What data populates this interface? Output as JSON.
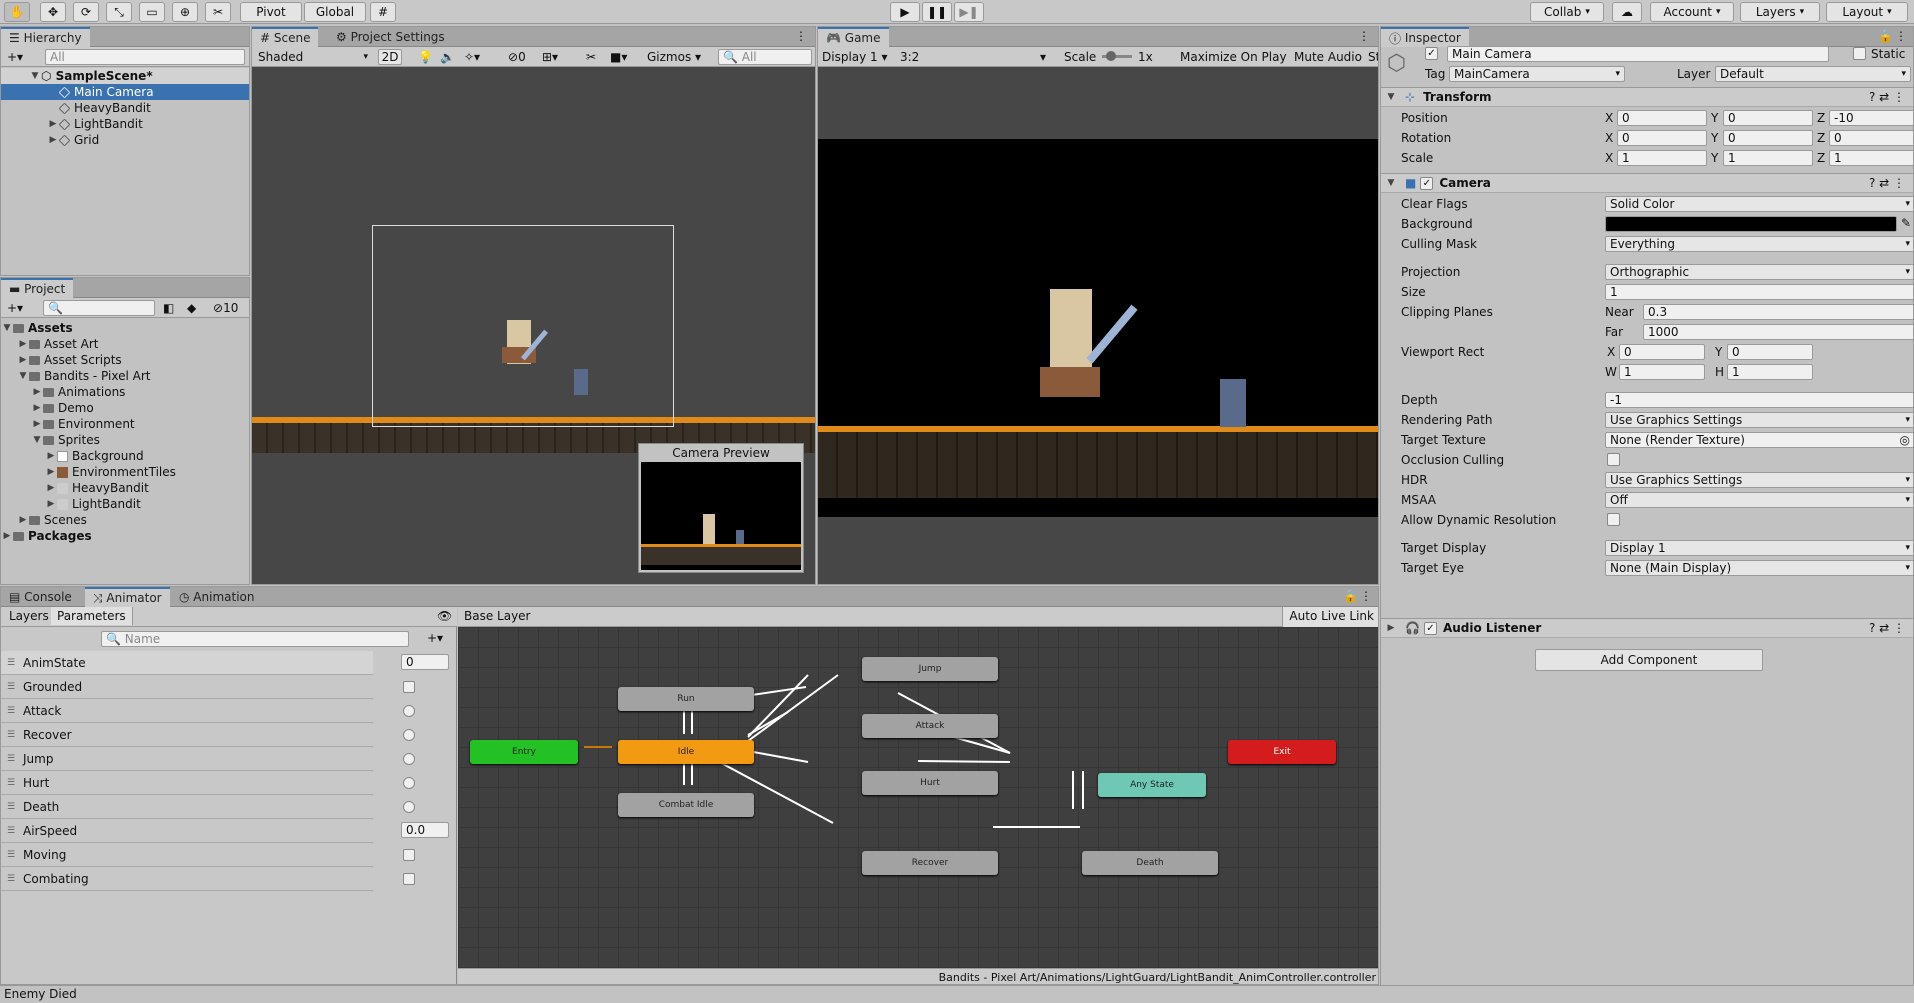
{
  "toolbar": {
    "pivot": "Pivot",
    "global": "Global",
    "collab": "Collab",
    "account": "Account",
    "layers": "Layers",
    "layout": "Layout"
  },
  "hierarchy": {
    "tab": "Hierarchy",
    "search": "All",
    "scene": "SampleScene*",
    "items": [
      "Main Camera",
      "HeavyBandit",
      "LightBandit",
      "Grid"
    ]
  },
  "project": {
    "tab": "Project",
    "count": "10",
    "root": "Assets",
    "items": [
      "Asset Art",
      "Asset Scripts",
      "Bandits - Pixel Art",
      "Animations",
      "Demo",
      "Environment",
      "Sprites",
      "Background",
      "EnvironmentTiles",
      "HeavyBandit",
      "LightBandit",
      "Scenes"
    ],
    "packages": "Packages"
  },
  "scene": {
    "tab": "Scene",
    "tab2": "Project Settings",
    "shading": "Shaded",
    "mode2d": "2D",
    "gizmos": "Gizmos",
    "search": "All",
    "hidden_count": "0",
    "preview_title": "Camera Preview"
  },
  "game": {
    "tab": "Game",
    "display": "Display 1",
    "aspect": "3:2",
    "scale_label": "Scale",
    "scale_value": "1x",
    "maximize": "Maximize On Play",
    "mute": "Mute Audio",
    "stats": "St"
  },
  "inspector": {
    "tab": "Inspector",
    "name": "Main Camera",
    "static": "Static",
    "tag_label": "Tag",
    "tag": "MainCamera",
    "layer_label": "Layer",
    "layer": "Default",
    "transform": {
      "title": "Transform",
      "rows": [
        {
          "label": "Position",
          "x": "0",
          "y": "0",
          "z": "-10"
        },
        {
          "label": "Rotation",
          "x": "0",
          "y": "0",
          "z": "0"
        },
        {
          "label": "Scale",
          "x": "1",
          "y": "1",
          "z": "1"
        }
      ]
    },
    "camera": {
      "title": "Camera",
      "clear_flags": "Solid Color",
      "culling_mask": "Everything",
      "projection": "Orthographic",
      "size": "1",
      "near": "0.3",
      "far": "1000",
      "vx": "0",
      "vy": "0",
      "vw": "1",
      "vh": "1",
      "depth": "-1",
      "rendering_path": "Use Graphics Settings",
      "target_texture": "None (Render Texture)",
      "hdr": "Use Graphics Settings",
      "msaa": "Off",
      "target_display": "Display 1",
      "target_eye": "None (Main Display)",
      "labels": {
        "clear_flags": "Clear Flags",
        "background": "Background",
        "culling_mask": "Culling Mask",
        "projection": "Projection",
        "size": "Size",
        "clipping": "Clipping Planes",
        "near": "Near",
        "far": "Far",
        "viewport": "Viewport Rect",
        "depth": "Depth",
        "rendering_path": "Rendering Path",
        "target_texture": "Target Texture",
        "occlusion": "Occlusion Culling",
        "hdr": "HDR",
        "msaa": "MSAA",
        "dynres": "Allow Dynamic Resolution",
        "target_display": "Target Display",
        "target_eye": "Target Eye"
      }
    },
    "audio": {
      "title": "Audio Listener"
    },
    "add_component": "Add Component"
  },
  "bottom": {
    "tabs": [
      "Console",
      "Animator",
      "Animation"
    ],
    "layers": "Layers",
    "parameters": "Parameters",
    "name_search": "Name",
    "base_layer": "Base Layer",
    "auto_live": "Auto Live Link",
    "path": "Bandits - Pixel Art/Animations/LightGuard/LightBandit_AnimController.controller",
    "params": [
      {
        "name": "AnimState",
        "kind": "int",
        "value": "0"
      },
      {
        "name": "Grounded",
        "kind": "bool"
      },
      {
        "name": "Attack",
        "kind": "trigger"
      },
      {
        "name": "Recover",
        "kind": "trigger"
      },
      {
        "name": "Jump",
        "kind": "trigger"
      },
      {
        "name": "Hurt",
        "kind": "trigger"
      },
      {
        "name": "Death",
        "kind": "trigger"
      },
      {
        "name": "AirSpeed",
        "kind": "float",
        "value": "0.0"
      },
      {
        "name": "Moving",
        "kind": "bool"
      },
      {
        "name": "Combating",
        "kind": "bool"
      }
    ],
    "nodes": {
      "entry": "Entry",
      "idle": "Idle",
      "run": "Run",
      "combat": "Combat Idle",
      "jump": "Jump",
      "attack": "Attack",
      "hurt": "Hurt",
      "recover": "Recover",
      "any": "Any State",
      "death": "Death",
      "exit": "Exit"
    }
  },
  "status": "Enemy Died"
}
